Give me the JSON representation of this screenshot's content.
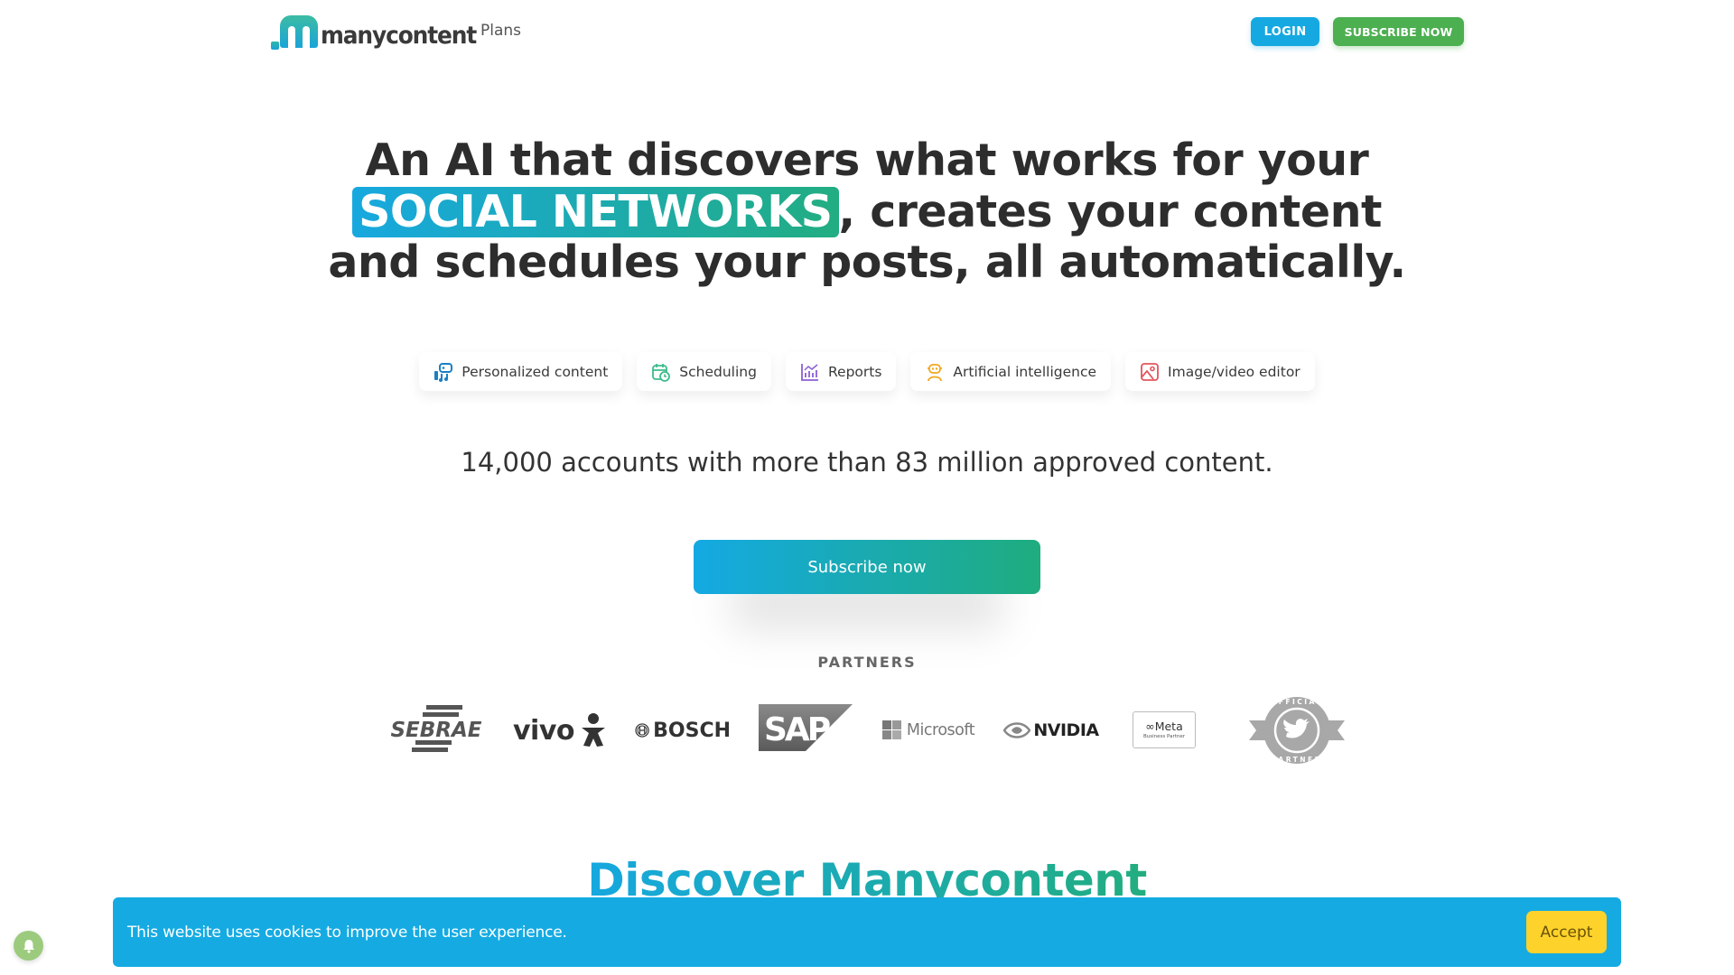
{
  "header": {
    "logo_text": "manycontent",
    "nav": [
      {
        "label": "Plans"
      }
    ],
    "login_label": "LOGIN",
    "subscribe_label": "SUBSCRIBE NOW"
  },
  "hero": {
    "line1": "An AI that discovers what works for your",
    "highlight": "SOCIAL NETWORKS",
    "line2_rest": ", creates your content",
    "line3": "and schedules your posts, all automatically."
  },
  "features": [
    {
      "label": "Personalized content",
      "icon": "personalized-content-icon"
    },
    {
      "label": "Scheduling",
      "icon": "calendar-clock-icon"
    },
    {
      "label": "Reports",
      "icon": "bar-chart-icon"
    },
    {
      "label": "Artificial intelligence",
      "icon": "robot-icon"
    },
    {
      "label": "Image/video editor",
      "icon": "image-icon"
    }
  ],
  "stats": "14,000 accounts with more than 83 million approved content.",
  "cta_label": "Subscribe now",
  "partners": {
    "label": "PARTNERS",
    "logos": [
      "SEBRAE",
      "vivo",
      "BOSCH",
      "SAP",
      "Microsoft",
      "NVIDIA",
      "Meta",
      "Business Partner",
      "OFFICIAL",
      "PARTNER"
    ]
  },
  "discover_title": "Discover Manycontent",
  "cookie": {
    "text": "This website uses cookies to improve the user experience.",
    "accept_label": "Accept"
  },
  "colors": {
    "blue": "#15abe2",
    "green": "#4caf50",
    "gradient_start": "#17a8df",
    "gradient_end": "#22ad81",
    "accept_yellow": "#fdd22b"
  }
}
